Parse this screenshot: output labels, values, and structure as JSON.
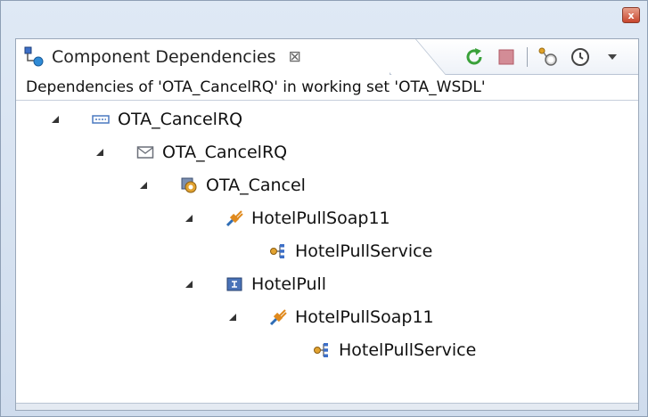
{
  "window": {
    "close_label": "x"
  },
  "view": {
    "tab": {
      "title": "Component Dependencies",
      "close_glyph": "⊠",
      "icon": "dependencies-view-icon"
    },
    "toolbar": {
      "buttons": [
        {
          "icon": "refresh-icon",
          "color": "#3aa13a"
        },
        {
          "icon": "stop-icon",
          "color": "#c0505a"
        },
        {
          "icon": "dependency-search-icon"
        },
        {
          "icon": "history-icon"
        },
        {
          "icon": "view-menu-icon"
        }
      ]
    },
    "info": "Dependencies of 'OTA_CancelRQ' in working set 'OTA_WSDL'"
  },
  "tree": {
    "nodes": [
      {
        "label": "OTA_CancelRQ",
        "icon": "element-icon",
        "expanded": true
      },
      {
        "label": "OTA_CancelRQ",
        "icon": "message-icon",
        "expanded": true
      },
      {
        "label": "OTA_Cancel",
        "icon": "operation-icon",
        "expanded": true
      },
      {
        "label": "HotelPullSoap11",
        "icon": "binding-icon",
        "expanded": true
      },
      {
        "label": "HotelPullService",
        "icon": "service-icon",
        "expanded": false
      },
      {
        "label": "HotelPull",
        "icon": "port-type-icon",
        "expanded": true
      },
      {
        "label": "HotelPullSoap11",
        "icon": "binding-icon",
        "expanded": true
      },
      {
        "label": "HotelPullService",
        "icon": "service-icon",
        "expanded": false
      }
    ]
  }
}
